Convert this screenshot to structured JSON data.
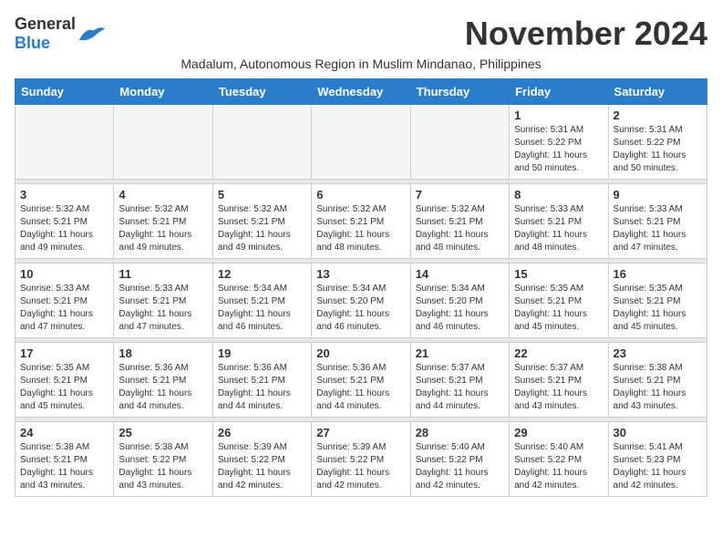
{
  "header": {
    "logo_general": "General",
    "logo_blue": "Blue",
    "month_title": "November 2024",
    "subtitle": "Madalum, Autonomous Region in Muslim Mindanao, Philippines"
  },
  "weekdays": [
    "Sunday",
    "Monday",
    "Tuesday",
    "Wednesday",
    "Thursday",
    "Friday",
    "Saturday"
  ],
  "weeks": [
    [
      {
        "day": "",
        "sunrise": "",
        "sunset": "",
        "daylight": "",
        "empty": true
      },
      {
        "day": "",
        "sunrise": "",
        "sunset": "",
        "daylight": "",
        "empty": true
      },
      {
        "day": "",
        "sunrise": "",
        "sunset": "",
        "daylight": "",
        "empty": true
      },
      {
        "day": "",
        "sunrise": "",
        "sunset": "",
        "daylight": "",
        "empty": true
      },
      {
        "day": "",
        "sunrise": "",
        "sunset": "",
        "daylight": "",
        "empty": true
      },
      {
        "day": "1",
        "sunrise": "Sunrise: 5:31 AM",
        "sunset": "Sunset: 5:22 PM",
        "daylight": "Daylight: 11 hours and 50 minutes.",
        "empty": false
      },
      {
        "day": "2",
        "sunrise": "Sunrise: 5:31 AM",
        "sunset": "Sunset: 5:22 PM",
        "daylight": "Daylight: 11 hours and 50 minutes.",
        "empty": false
      }
    ],
    [
      {
        "day": "3",
        "sunrise": "Sunrise: 5:32 AM",
        "sunset": "Sunset: 5:21 PM",
        "daylight": "Daylight: 11 hours and 49 minutes.",
        "empty": false
      },
      {
        "day": "4",
        "sunrise": "Sunrise: 5:32 AM",
        "sunset": "Sunset: 5:21 PM",
        "daylight": "Daylight: 11 hours and 49 minutes.",
        "empty": false
      },
      {
        "day": "5",
        "sunrise": "Sunrise: 5:32 AM",
        "sunset": "Sunset: 5:21 PM",
        "daylight": "Daylight: 11 hours and 49 minutes.",
        "empty": false
      },
      {
        "day": "6",
        "sunrise": "Sunrise: 5:32 AM",
        "sunset": "Sunset: 5:21 PM",
        "daylight": "Daylight: 11 hours and 48 minutes.",
        "empty": false
      },
      {
        "day": "7",
        "sunrise": "Sunrise: 5:32 AM",
        "sunset": "Sunset: 5:21 PM",
        "daylight": "Daylight: 11 hours and 48 minutes.",
        "empty": false
      },
      {
        "day": "8",
        "sunrise": "Sunrise: 5:33 AM",
        "sunset": "Sunset: 5:21 PM",
        "daylight": "Daylight: 11 hours and 48 minutes.",
        "empty": false
      },
      {
        "day": "9",
        "sunrise": "Sunrise: 5:33 AM",
        "sunset": "Sunset: 5:21 PM",
        "daylight": "Daylight: 11 hours and 47 minutes.",
        "empty": false
      }
    ],
    [
      {
        "day": "10",
        "sunrise": "Sunrise: 5:33 AM",
        "sunset": "Sunset: 5:21 PM",
        "daylight": "Daylight: 11 hours and 47 minutes.",
        "empty": false
      },
      {
        "day": "11",
        "sunrise": "Sunrise: 5:33 AM",
        "sunset": "Sunset: 5:21 PM",
        "daylight": "Daylight: 11 hours and 47 minutes.",
        "empty": false
      },
      {
        "day": "12",
        "sunrise": "Sunrise: 5:34 AM",
        "sunset": "Sunset: 5:21 PM",
        "daylight": "Daylight: 11 hours and 46 minutes.",
        "empty": false
      },
      {
        "day": "13",
        "sunrise": "Sunrise: 5:34 AM",
        "sunset": "Sunset: 5:20 PM",
        "daylight": "Daylight: 11 hours and 46 minutes.",
        "empty": false
      },
      {
        "day": "14",
        "sunrise": "Sunrise: 5:34 AM",
        "sunset": "Sunset: 5:20 PM",
        "daylight": "Daylight: 11 hours and 46 minutes.",
        "empty": false
      },
      {
        "day": "15",
        "sunrise": "Sunrise: 5:35 AM",
        "sunset": "Sunset: 5:21 PM",
        "daylight": "Daylight: 11 hours and 45 minutes.",
        "empty": false
      },
      {
        "day": "16",
        "sunrise": "Sunrise: 5:35 AM",
        "sunset": "Sunset: 5:21 PM",
        "daylight": "Daylight: 11 hours and 45 minutes.",
        "empty": false
      }
    ],
    [
      {
        "day": "17",
        "sunrise": "Sunrise: 5:35 AM",
        "sunset": "Sunset: 5:21 PM",
        "daylight": "Daylight: 11 hours and 45 minutes.",
        "empty": false
      },
      {
        "day": "18",
        "sunrise": "Sunrise: 5:36 AM",
        "sunset": "Sunset: 5:21 PM",
        "daylight": "Daylight: 11 hours and 44 minutes.",
        "empty": false
      },
      {
        "day": "19",
        "sunrise": "Sunrise: 5:36 AM",
        "sunset": "Sunset: 5:21 PM",
        "daylight": "Daylight: 11 hours and 44 minutes.",
        "empty": false
      },
      {
        "day": "20",
        "sunrise": "Sunrise: 5:36 AM",
        "sunset": "Sunset: 5:21 PM",
        "daylight": "Daylight: 11 hours and 44 minutes.",
        "empty": false
      },
      {
        "day": "21",
        "sunrise": "Sunrise: 5:37 AM",
        "sunset": "Sunset: 5:21 PM",
        "daylight": "Daylight: 11 hours and 44 minutes.",
        "empty": false
      },
      {
        "day": "22",
        "sunrise": "Sunrise: 5:37 AM",
        "sunset": "Sunset: 5:21 PM",
        "daylight": "Daylight: 11 hours and 43 minutes.",
        "empty": false
      },
      {
        "day": "23",
        "sunrise": "Sunrise: 5:38 AM",
        "sunset": "Sunset: 5:21 PM",
        "daylight": "Daylight: 11 hours and 43 minutes.",
        "empty": false
      }
    ],
    [
      {
        "day": "24",
        "sunrise": "Sunrise: 5:38 AM",
        "sunset": "Sunset: 5:21 PM",
        "daylight": "Daylight: 11 hours and 43 minutes.",
        "empty": false
      },
      {
        "day": "25",
        "sunrise": "Sunrise: 5:38 AM",
        "sunset": "Sunset: 5:22 PM",
        "daylight": "Daylight: 11 hours and 43 minutes.",
        "empty": false
      },
      {
        "day": "26",
        "sunrise": "Sunrise: 5:39 AM",
        "sunset": "Sunset: 5:22 PM",
        "daylight": "Daylight: 11 hours and 42 minutes.",
        "empty": false
      },
      {
        "day": "27",
        "sunrise": "Sunrise: 5:39 AM",
        "sunset": "Sunset: 5:22 PM",
        "daylight": "Daylight: 11 hours and 42 minutes.",
        "empty": false
      },
      {
        "day": "28",
        "sunrise": "Sunrise: 5:40 AM",
        "sunset": "Sunset: 5:22 PM",
        "daylight": "Daylight: 11 hours and 42 minutes.",
        "empty": false
      },
      {
        "day": "29",
        "sunrise": "Sunrise: 5:40 AM",
        "sunset": "Sunset: 5:22 PM",
        "daylight": "Daylight: 11 hours and 42 minutes.",
        "empty": false
      },
      {
        "day": "30",
        "sunrise": "Sunrise: 5:41 AM",
        "sunset": "Sunset: 5:23 PM",
        "daylight": "Daylight: 11 hours and 42 minutes.",
        "empty": false
      }
    ]
  ]
}
